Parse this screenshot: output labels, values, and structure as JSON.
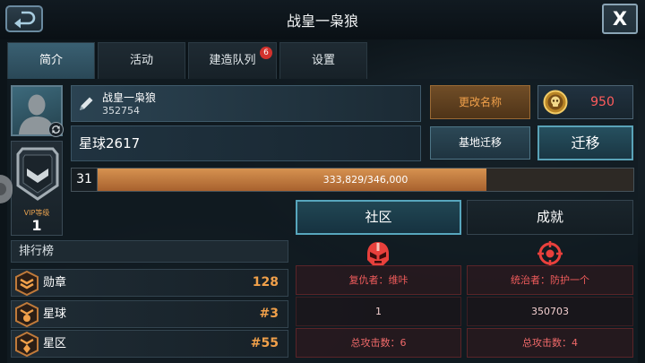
{
  "header": {
    "title": "战皇一枭狼",
    "close_label": "X"
  },
  "tabs": [
    {
      "label": "简介",
      "active": true
    },
    {
      "label": "活动",
      "active": false
    },
    {
      "label": "建造队列",
      "active": false,
      "badge": "6"
    },
    {
      "label": "设置",
      "active": false
    }
  ],
  "profile": {
    "name": "战皇一枭狼",
    "id": "352754",
    "planet": "星球2617",
    "avatar_icon": "avatar-silhouette-icon"
  },
  "actions": {
    "rename_label": "更改名称",
    "relocate_base_label": "基地迁移",
    "relocate_label": "迁移"
  },
  "currency": {
    "amount": "950",
    "icon": "coin-icon"
  },
  "vip": {
    "label": "VIP等级",
    "level": "1",
    "icon": "vip-shield-icon"
  },
  "level": {
    "value": "31",
    "progress_text": "333,829/346,000",
    "fill_fraction": 0.725
  },
  "panel_tabs": {
    "community": "社区",
    "achievements": "成就",
    "community_active": true
  },
  "leaderboard": {
    "title": "排行榜",
    "rows": [
      {
        "label": "勋章",
        "value": "128",
        "icon": "medal-rank-icon"
      },
      {
        "label": "星球",
        "value": "#3",
        "icon": "planet-rank-icon"
      },
      {
        "label": "星区",
        "value": "#55",
        "icon": "sector-rank-icon"
      }
    ]
  },
  "stats": [
    {
      "icon": "helmet-icon",
      "title": "复仇者：维咔",
      "value": "1",
      "attacks": "总攻击数：6"
    },
    {
      "icon": "crosshair-icon",
      "title": "统治者：防护一个",
      "value": "350703",
      "attacks": "总攻击数：4"
    }
  ],
  "colors": {
    "background": "#0c1419",
    "accent_teal": "#57a6bd",
    "accent_orange": "#f0a04a",
    "danger_red": "#f25c5c",
    "currency_red": "#ff5c5c",
    "badge_red": "#d2322d"
  }
}
